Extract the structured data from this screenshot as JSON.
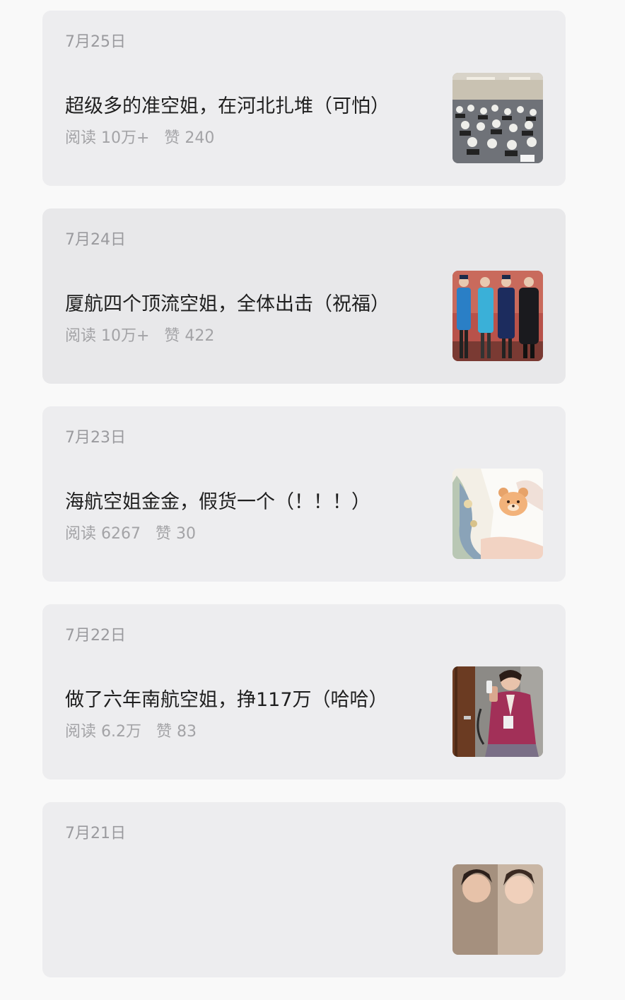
{
  "articles": [
    {
      "date": "7月25日",
      "title": "超级多的准空姐，在河北扎堆（可怕）",
      "reads": "阅读 10万+",
      "likes": "赞 240",
      "thumb": "group-seated-photo"
    },
    {
      "date": "7月24日",
      "title": "厦航四个顶流空姐，全体出击（祝福）",
      "reads": "阅读 10万+",
      "likes": "赞 422",
      "thumb": "four-uniforms-photo"
    },
    {
      "date": "7月23日",
      "title": "海航空姐金金，假货一个（！！！）",
      "reads": "阅读 6267",
      "likes": "赞 30",
      "thumb": "illustration-bear-photo"
    },
    {
      "date": "7月22日",
      "title": "做了六年南航空姐，挣117万（哈哈）",
      "reads": "阅读 6.2万",
      "likes": "赞 83",
      "thumb": "attendant-selfie-photo"
    },
    {
      "date": "7月21日",
      "title": "",
      "reads": "",
      "likes": "",
      "thumb": "two-faces-photo"
    }
  ]
}
